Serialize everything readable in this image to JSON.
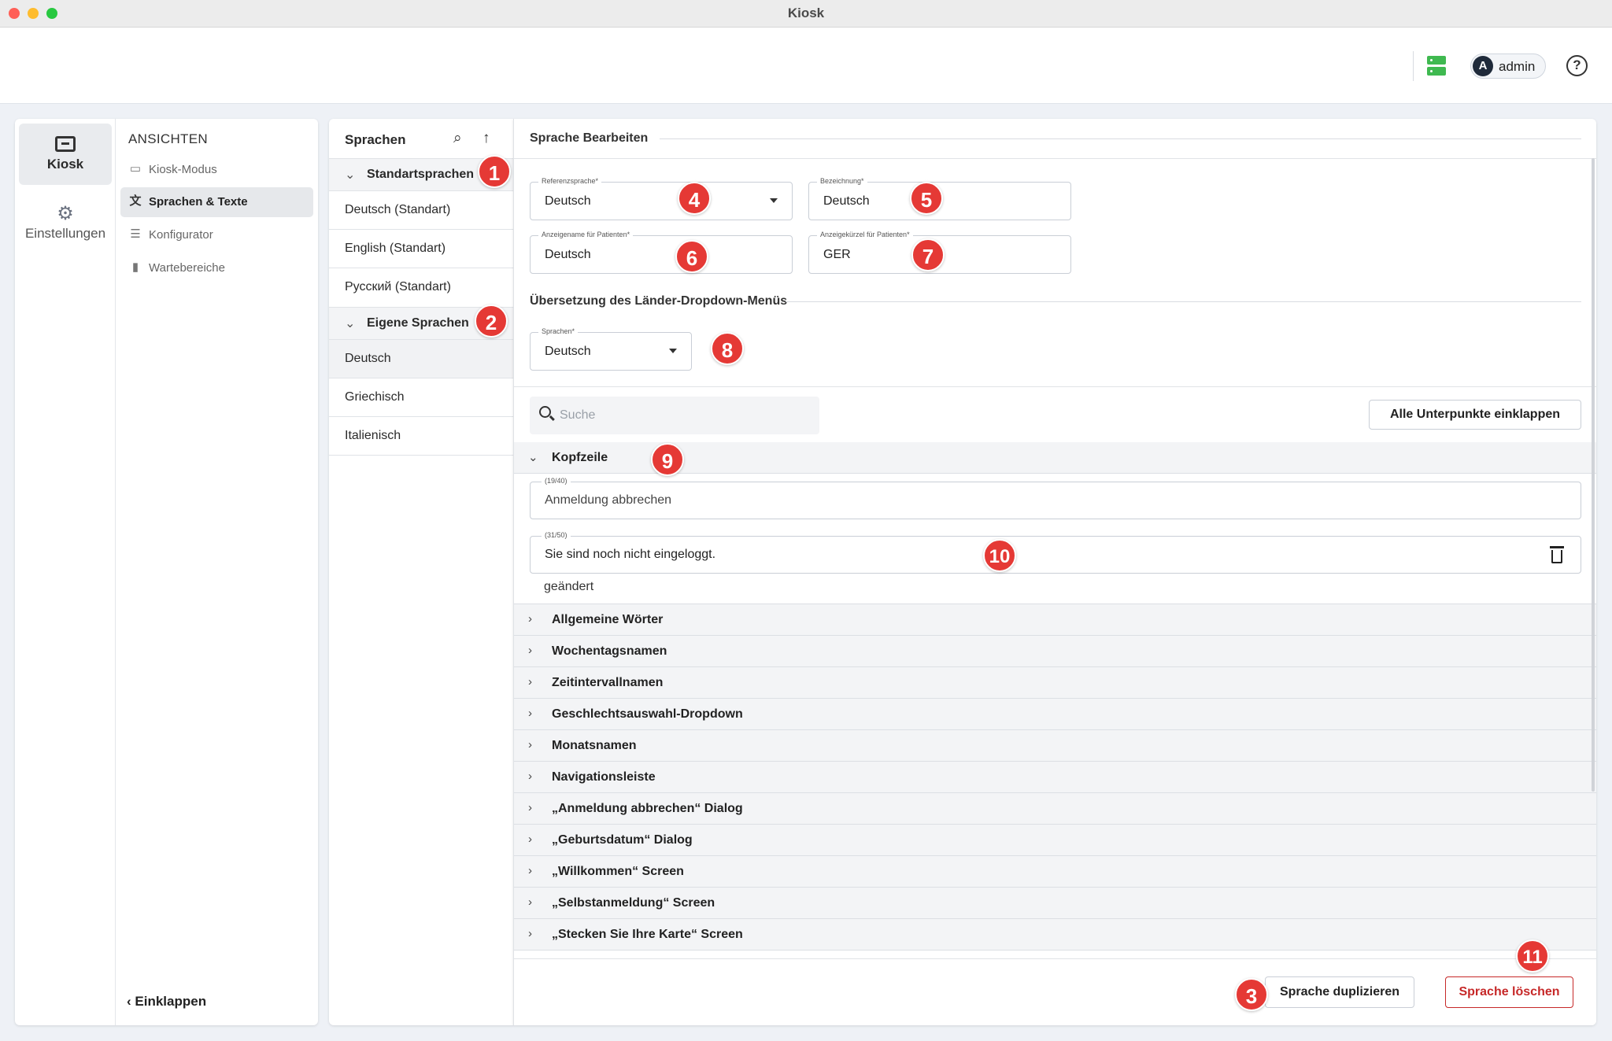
{
  "window": {
    "title": "Kiosk"
  },
  "header": {
    "user_initial": "A",
    "user_name": "admin",
    "help": "?"
  },
  "rail": {
    "kiosk": "Kiosk",
    "settings": "Einstellungen"
  },
  "nav": {
    "heading": "ANSICHTEN",
    "items": [
      {
        "label": "Kiosk-Modus",
        "icon": "monitor-icon"
      },
      {
        "label": "Sprachen & Texte",
        "icon": "translate-icon"
      },
      {
        "label": "Konfigurator",
        "icon": "sliders-icon"
      },
      {
        "label": "Wartebereiche",
        "icon": "door-icon"
      }
    ],
    "collapse": "Einklappen"
  },
  "languages": {
    "title": "Sprachen",
    "standard_group": "Standartsprachen",
    "standard": [
      "Deutsch (Standart)",
      "English (Standart)",
      "Русский (Standart)"
    ],
    "custom_group": "Eigene Sprachen",
    "custom": [
      "Deutsch",
      "Griechisch",
      "Italienisch"
    ],
    "selected": "Deutsch"
  },
  "edit": {
    "title": "Sprache Bearbeiten",
    "reference": {
      "label": "Referenzsprache*",
      "value": "Deutsch"
    },
    "name": {
      "label": "Bezeichnung*",
      "value": "Deutsch"
    },
    "display_name": {
      "label": "Anzeigename für Patienten*",
      "value": "Deutsch"
    },
    "display_short": {
      "label": "Anzeigekürzel für Patienten*",
      "value": "GER"
    },
    "countries_title": "Übersetzung des Länder-Dropdown-Menüs",
    "countries_lang": {
      "label": "Sprachen*",
      "value": "Deutsch"
    },
    "search_placeholder": "Suche",
    "collapse_all": "Alle Unterpunkte einklappen"
  },
  "sections": {
    "expanded": {
      "label": "Kopfzeile",
      "fields": [
        {
          "count": "(19/40)",
          "value": "Anmeldung abbrechen"
        },
        {
          "count": "(31/50)",
          "value": "Sie sind noch nicht eingeloggt.",
          "note": "geändert"
        }
      ]
    },
    "collapsed": [
      "Allgemeine Wörter",
      "Wochentagsnamen",
      "Zeitintervallnamen",
      "Geschlechtsauswahl-Dropdown",
      "Monatsnamen",
      "Navigationsleiste",
      "„Anmeldung abbrechen“ Dialog",
      "„Geburtsdatum“ Dialog",
      "„Willkommen“ Screen",
      "„Selbstanmeldung“ Screen",
      "„Stecken Sie Ihre Karte“ Screen"
    ]
  },
  "footer": {
    "duplicate": "Sprache duplizieren",
    "delete": "Sprache löschen"
  },
  "badges": [
    "1",
    "2",
    "3",
    "4",
    "5",
    "6",
    "7",
    "8",
    "9",
    "10",
    "11"
  ],
  "colors": {
    "badge": "#e53935",
    "danger": "#c62828",
    "server": "#3fb950"
  }
}
